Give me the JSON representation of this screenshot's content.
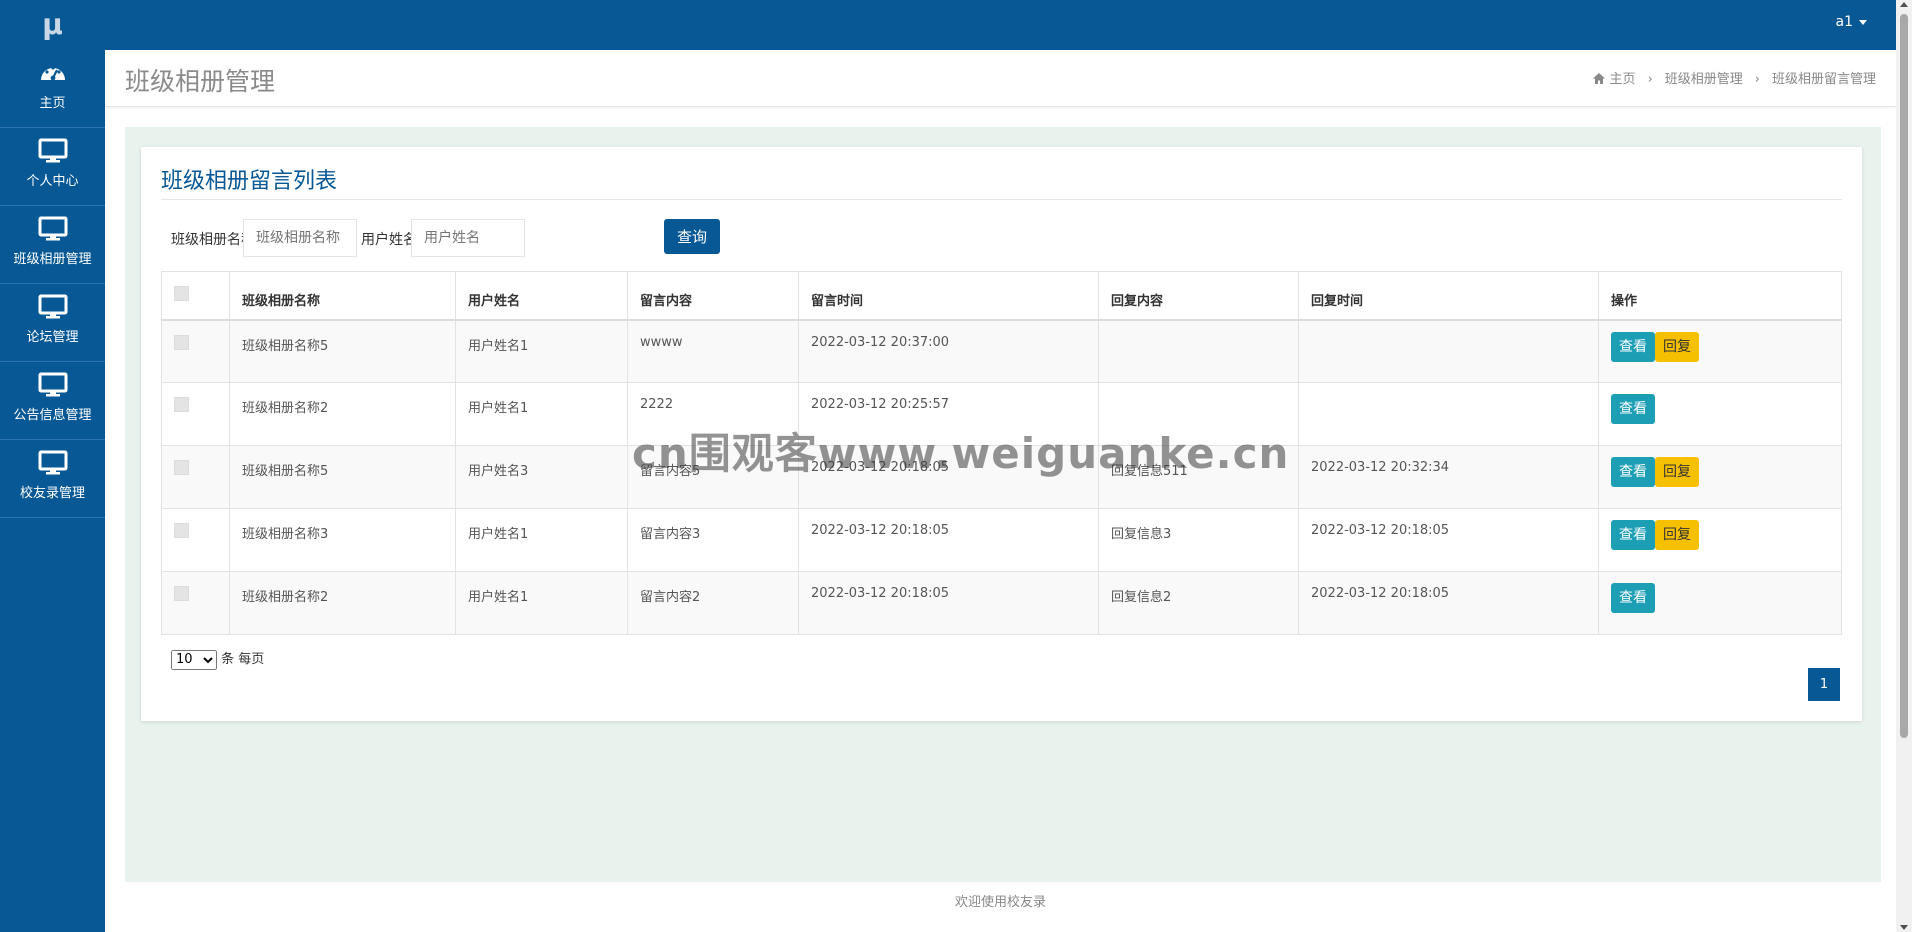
{
  "app": {
    "logo": "μ"
  },
  "user": {
    "name": "a1"
  },
  "sidebar": {
    "items": [
      {
        "label": "主页",
        "icon": "dashboard-icon"
      },
      {
        "label": "个人中心",
        "icon": "monitor-icon"
      },
      {
        "label": "班级相册管理",
        "icon": "monitor-icon"
      },
      {
        "label": "论坛管理",
        "icon": "monitor-icon"
      },
      {
        "label": "公告信息管理",
        "icon": "monitor-icon"
      },
      {
        "label": "校友录管理",
        "icon": "monitor-icon"
      }
    ]
  },
  "header": {
    "title": "班级相册管理",
    "breadcrumb": [
      "主页",
      "班级相册管理",
      "班级相册留言管理"
    ]
  },
  "card": {
    "title": "班级相册留言列表"
  },
  "search": {
    "album_label": "班级相册名称",
    "album_placeholder": "班级相册名称",
    "user_label": "用户姓名",
    "user_placeholder": "用户姓名",
    "query_label": "查询"
  },
  "table": {
    "columns": [
      "班级相册名称",
      "用户姓名",
      "留言内容",
      "留言时间",
      "回复内容",
      "回复时间",
      "操作"
    ],
    "view_label": "查看",
    "reply_label": "回复",
    "rows": [
      {
        "album": "班级相册名称5",
        "user": "用户姓名1",
        "content": "wwww",
        "time": "2022-03-12 20:37:00",
        "reply": "",
        "reply_time": "",
        "has_reply_btn": true
      },
      {
        "album": "班级相册名称2",
        "user": "用户姓名1",
        "content": "2222",
        "time": "2022-03-12 20:25:57",
        "reply": "",
        "reply_time": "",
        "has_reply_btn": false
      },
      {
        "album": "班级相册名称5",
        "user": "用户姓名3",
        "content": "留言内容5",
        "time": "2022-03-12 20:18:05",
        "reply": "回复信息511",
        "reply_time": "2022-03-12 20:32:34",
        "has_reply_btn": true
      },
      {
        "album": "班级相册名称3",
        "user": "用户姓名1",
        "content": "留言内容3",
        "time": "2022-03-12 20:18:05",
        "reply": "回复信息3",
        "reply_time": "2022-03-12 20:18:05",
        "has_reply_btn": true
      },
      {
        "album": "班级相册名称2",
        "user": "用户姓名1",
        "content": "留言内容2",
        "time": "2022-03-12 20:18:05",
        "reply": "回复信息2",
        "reply_time": "2022-03-12 20:18:05",
        "has_reply_btn": false
      }
    ]
  },
  "pagination": {
    "page_size": "10",
    "page_size_options": [
      "10"
    ],
    "page_size_suffix": "条 每页",
    "current_page": "1"
  },
  "footer": {
    "text": "欢迎使用校友录"
  },
  "watermark": {
    "text": "cn围观客www.weiguanke.cn"
  },
  "colors": {
    "primary": "#075894",
    "view": "#1c9eb5",
    "reply": "#f5c000",
    "content_bg": "#e9f3ee"
  }
}
